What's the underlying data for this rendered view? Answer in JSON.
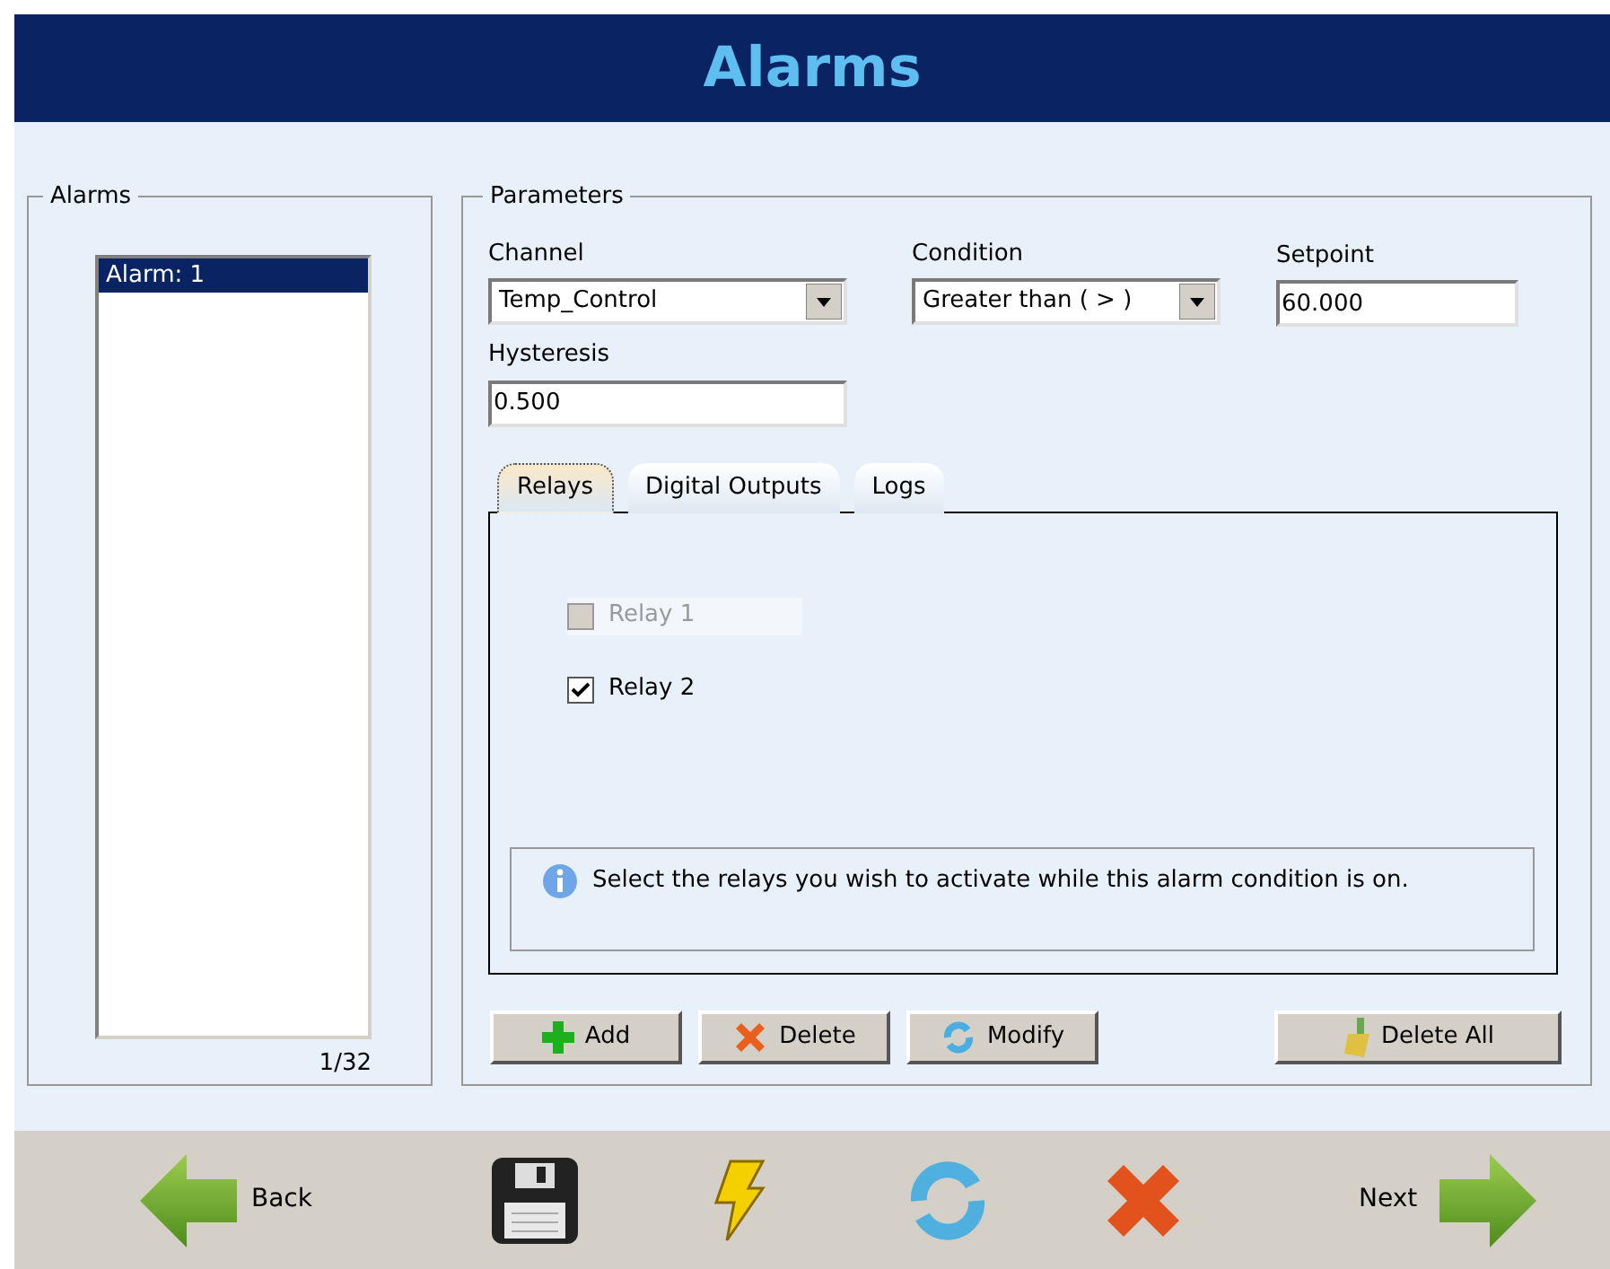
{
  "header": {
    "title": "Alarms"
  },
  "alarms_group": {
    "legend": "Alarms",
    "items": [
      {
        "label": "Alarm: 1",
        "selected": true
      }
    ],
    "count": "1/32"
  },
  "parameters_group": {
    "legend": "Parameters",
    "channel": {
      "label": "Channel",
      "value": "Temp_Control"
    },
    "condition": {
      "label": "Condition",
      "value": "Greater than ( > )"
    },
    "setpoint": {
      "label": "Setpoint",
      "value": "60.000"
    },
    "hysteresis": {
      "label": "Hysteresis",
      "value": "0.500"
    },
    "tabs": [
      {
        "label": "Relays",
        "selected": true
      },
      {
        "label": "Digital Outputs",
        "selected": false
      },
      {
        "label": "Logs",
        "selected": false
      }
    ],
    "relays": [
      {
        "label": "Relay 1",
        "checked": false,
        "disabled": true
      },
      {
        "label": "Relay 2",
        "checked": true,
        "disabled": false
      }
    ],
    "info": "Select the relays you wish to activate while this alarm condition is on.",
    "buttons": [
      {
        "kind": "add",
        "label": "Add"
      },
      {
        "kind": "delete",
        "label": "Delete"
      },
      {
        "kind": "modify",
        "label": "Modify"
      },
      {
        "kind": "clear",
        "label": "Delete All"
      }
    ]
  },
  "footer": {
    "back": "Back",
    "next": "Next"
  }
}
